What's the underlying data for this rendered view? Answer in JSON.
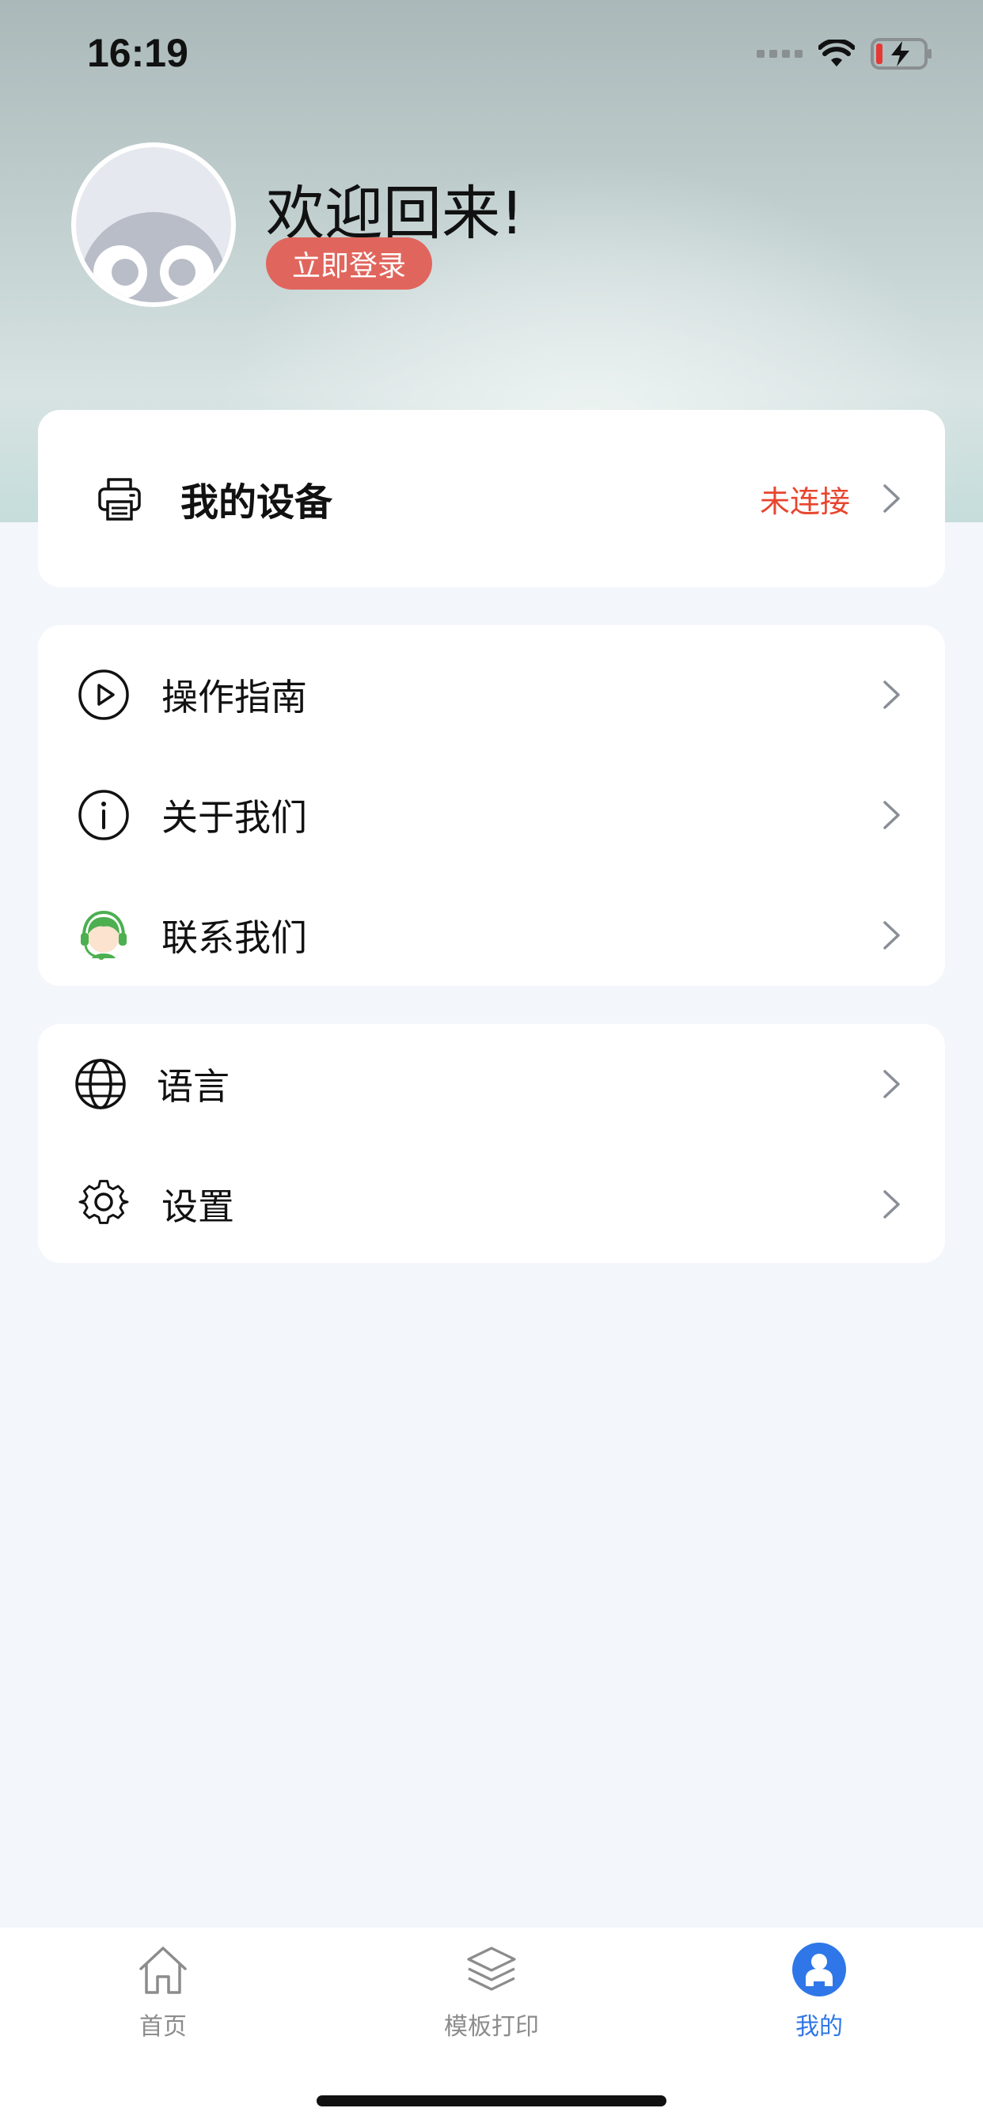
{
  "status_bar": {
    "time": "16:19"
  },
  "profile": {
    "welcome": "欢迎回来!",
    "login_label": "立即登录"
  },
  "device": {
    "label": "我的设备",
    "status": "未连接",
    "status_color": "#e8452f"
  },
  "menu_group_1": [
    {
      "label": "操作指南",
      "icon": "play-circle-icon"
    },
    {
      "label": "关于我们",
      "icon": "info-circle-icon"
    },
    {
      "label": "联系我们",
      "icon": "customer-service-icon"
    }
  ],
  "menu_group_2": [
    {
      "label": "语言",
      "icon": "globe-icon"
    },
    {
      "label": "设置",
      "icon": "gear-icon"
    }
  ],
  "tabbar": {
    "items": [
      {
        "label": "首页",
        "icon": "home-icon",
        "active": false
      },
      {
        "label": "模板打印",
        "icon": "layers-icon",
        "active": false
      },
      {
        "label": "我的",
        "icon": "user-icon",
        "active": true
      }
    ],
    "active_color": "#2f77e8"
  }
}
